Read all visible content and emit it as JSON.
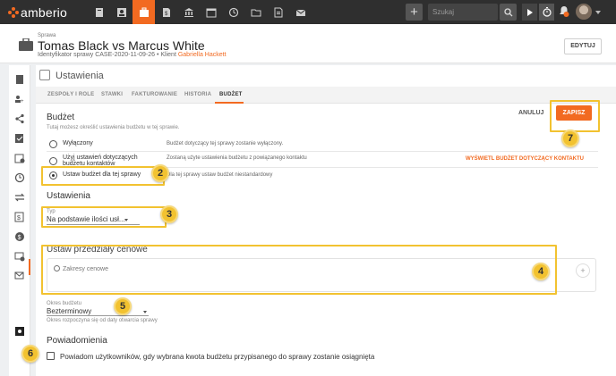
{
  "brand": {
    "name": "amberio",
    "accent": "#f26a21"
  },
  "topbar": {
    "nav_icons": [
      "book-icon",
      "contacts-icon",
      "briefcase-icon",
      "document-icon",
      "bank-icon",
      "calendar-icon",
      "history-icon",
      "folder-icon",
      "invoice-icon",
      "mail-icon"
    ],
    "active_nav": "briefcase-icon",
    "search_placeholder": "Szukaj wszystkiego..."
  },
  "case": {
    "kicker": "Sprawa",
    "title": "Tomas Black vs Marcus White",
    "id_label": "Identyfikator sprawy",
    "id_value": "CASE-2020-11-09-26",
    "separator": "•",
    "client_label": "Klient",
    "client_name": "Gabriella Hackett",
    "edit_label": "EDYTUJ"
  },
  "sidebar": {
    "icons": [
      "book-icon",
      "people-icon",
      "share-icon",
      "checklist-icon",
      "calendar-check-icon",
      "timer-icon",
      "transfer-icon",
      "billing-icon",
      "money-icon",
      "mail-clock-icon",
      "mail-check-icon",
      "settings-icon"
    ],
    "active": "settings-icon"
  },
  "main": {
    "title": "Ustawienia",
    "tabs": [
      {
        "label": "ZESPOŁY I ROLE",
        "active": false
      },
      {
        "label": "STAWKI",
        "active": false
      },
      {
        "label": "FAKTUROWANIE",
        "active": false
      },
      {
        "label": "HISTORIA",
        "active": false
      },
      {
        "label": "BUDŻET",
        "active": true
      }
    ]
  },
  "budget": {
    "heading": "Budżet",
    "subtitle": "Tutaj możesz określić ustawienia budżetu w tej sprawie.",
    "cancel_label": "ANULUJ",
    "save_label": "ZAPISZ",
    "options": [
      {
        "label": "Wyłączony",
        "description": "Budżet dotyczący tej sprawy zostanie wyłączony.",
        "checked": false
      },
      {
        "label": "Użyj ustawień dotyczących budżetu kontaktów",
        "description": "Zostaną użyte ustawienia budżetu z powiązanego kontaktu",
        "checked": false
      },
      {
        "label": "Ustaw budżet dla tej sprawy",
        "description": "Dla tej sprawy ustaw budżet niestandardowy",
        "checked": true
      }
    ],
    "contact_budget_link": "WYŚWIETL BUDŻET DOTYCZĄCY KONTAKTU"
  },
  "settings": {
    "heading": "Ustawienia",
    "type_label": "Typ",
    "type_value": "Na podstawie ilości usł..."
  },
  "ranges": {
    "heading": "Ustaw przedziały cenowe",
    "placeholder": "Zakresy cenowe",
    "add_symbol": "+"
  },
  "period": {
    "label": "Okres budżetu",
    "value": "Bezterminowy",
    "hint": "Okres rozpoczyna się od daty otwarcia sprawy"
  },
  "notifications": {
    "heading": "Powiadomienia",
    "checkbox_label": "Powiadom użytkowników, gdy wybrana kwota budżetu przypisanego do sprawy zostanie osiągnięta",
    "checked": false
  },
  "annotations": {
    "badges": [
      "2",
      "3",
      "4",
      "5",
      "6",
      "7"
    ],
    "highlight_color": "#f2c230"
  }
}
